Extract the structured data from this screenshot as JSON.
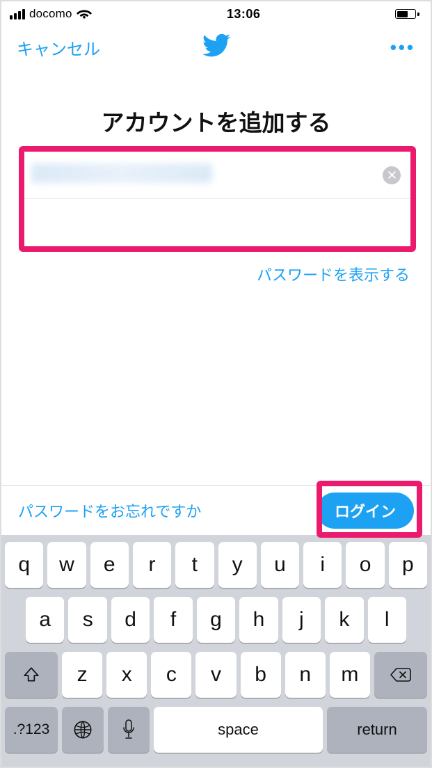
{
  "status": {
    "carrier": "docomo",
    "time": "13:06"
  },
  "nav": {
    "cancel": "キャンセル",
    "more": "•••"
  },
  "title": "アカウントを追加する",
  "form": {
    "showPassword": "パスワードを表示する"
  },
  "bottom": {
    "forgot": "パスワードをお忘れですか",
    "login": "ログイン"
  },
  "keyboard": {
    "row1": [
      "q",
      "w",
      "e",
      "r",
      "t",
      "y",
      "u",
      "i",
      "o",
      "p"
    ],
    "row2": [
      "a",
      "s",
      "d",
      "f",
      "g",
      "h",
      "j",
      "k",
      "l"
    ],
    "row3": [
      "z",
      "x",
      "c",
      "v",
      "b",
      "n",
      "m"
    ],
    "numKey": ".?123",
    "space": "space",
    "return": "return"
  }
}
